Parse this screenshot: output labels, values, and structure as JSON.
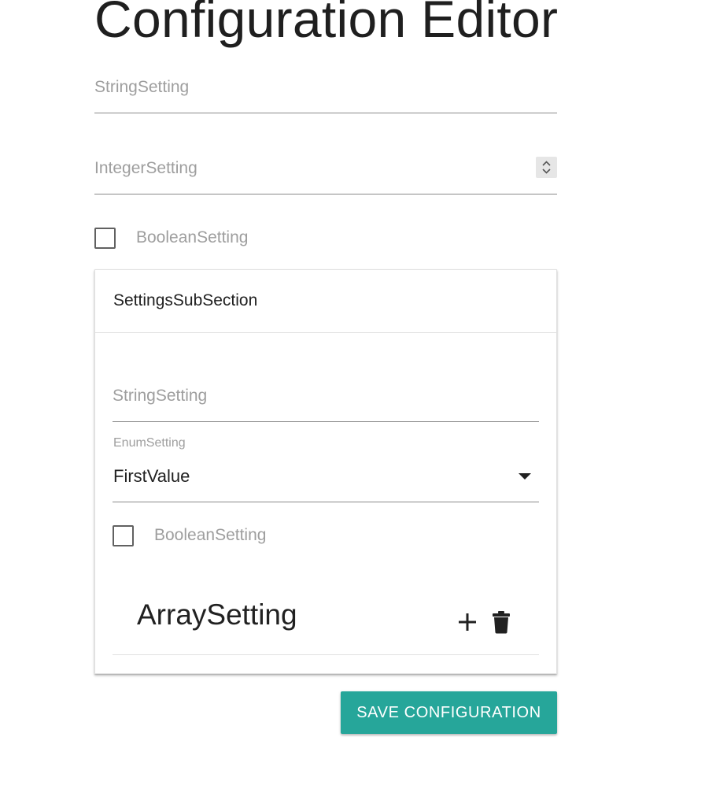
{
  "page": {
    "title": "Configuration Editor"
  },
  "fields": {
    "string_setting": {
      "placeholder": "StringSetting",
      "value": ""
    },
    "integer_setting": {
      "placeholder": "IntegerSetting",
      "value": ""
    },
    "boolean_setting": {
      "label": "BooleanSetting",
      "checked": false
    }
  },
  "subsection": {
    "title": "SettingsSubSection",
    "string_setting": {
      "placeholder": "StringSetting",
      "value": ""
    },
    "enum_setting": {
      "label": "EnumSetting",
      "selected": "FirstValue"
    },
    "boolean_setting": {
      "label": "BooleanSetting",
      "checked": false
    },
    "array_setting": {
      "title": "ArraySetting"
    }
  },
  "actions": {
    "save_label": "SAVE CONFIGURATION"
  },
  "icons": {
    "stepper": "number-stepper-icon",
    "enum_arrow": "dropdown-arrow-icon",
    "add": "plus-icon",
    "delete": "trash-icon"
  },
  "colors": {
    "accent": "#26a69a",
    "placeholder": "#9e9e9e",
    "text": "#212121"
  }
}
